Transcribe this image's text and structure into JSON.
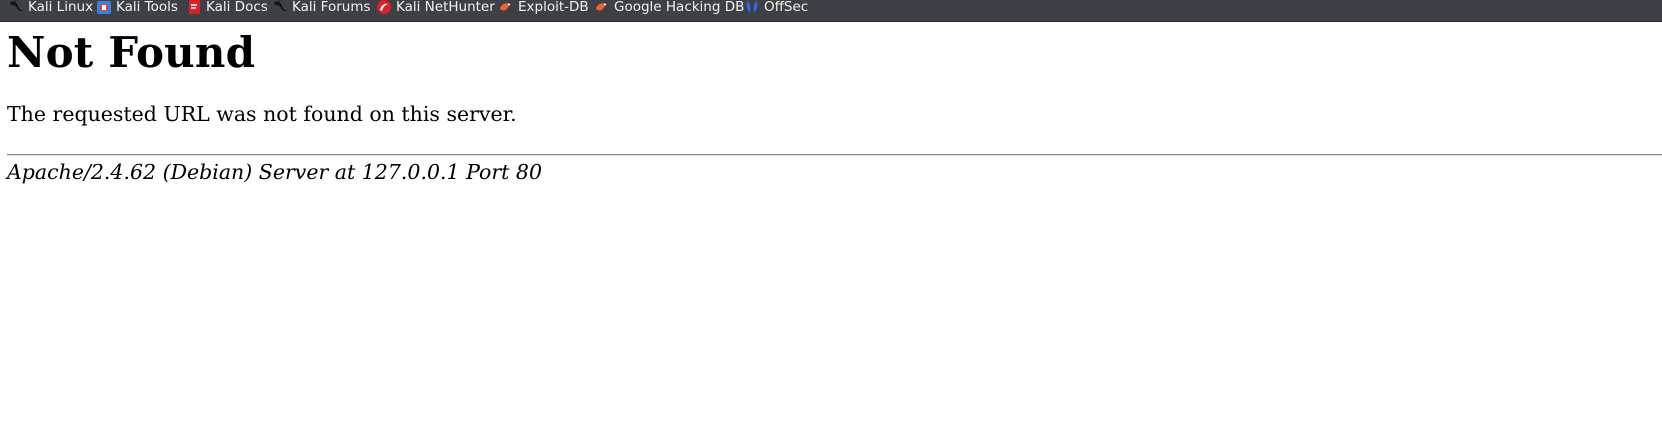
{
  "bookmarks_toolbar": {
    "items": [
      {
        "label": "Kali Linux",
        "icon": "kali-dragon-icon"
      },
      {
        "label": "Kali Tools",
        "icon": "kali-tools-icon"
      },
      {
        "label": "Kali Docs",
        "icon": "kali-docs-icon"
      },
      {
        "label": "Kali Forums",
        "icon": "kali-dragon-icon"
      },
      {
        "label": "Kali NetHunter",
        "icon": "nethunter-icon"
      },
      {
        "label": "Exploit-DB",
        "icon": "exploit-db-icon"
      },
      {
        "label": "Google Hacking DB",
        "icon": "exploit-db-icon"
      },
      {
        "label": "OffSec",
        "icon": "offsec-icon"
      }
    ]
  },
  "page": {
    "title": "Not Found",
    "message": "The requested URL was not found on this server.",
    "server_signature": "Apache/2.4.62 (Debian) Server at 127.0.0.1 Port 80"
  },
  "colors": {
    "toolbar_bg": "#3d4045",
    "toolbar_text": "#f2f2f2",
    "page_bg": "#ffffff",
    "kali_red": "#d7232b",
    "exploit_orange": "#f0662a",
    "offsec_blue": "#2e6cd9"
  }
}
